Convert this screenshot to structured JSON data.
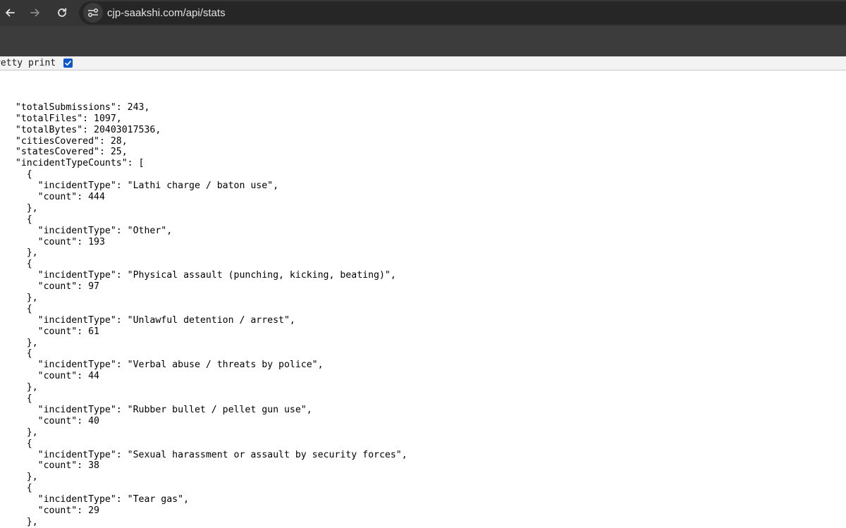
{
  "browser": {
    "url": "cjp-saakshi.com/api/stats"
  },
  "pretty_print": {
    "label": "retty print",
    "checked": true
  },
  "json_lines": [
    "",
    "  \"totalSubmissions\": 243,",
    "  \"totalFiles\": 1097,",
    "  \"totalBytes\": 20403017536,",
    "  \"citiesCovered\": 28,",
    "  \"statesCovered\": 25,",
    "  \"incidentTypeCounts\": [",
    "    {",
    "      \"incidentType\": \"Lathi charge / baton use\",",
    "      \"count\": 444",
    "    },",
    "    {",
    "      \"incidentType\": \"Other\",",
    "      \"count\": 193",
    "    },",
    "    {",
    "      \"incidentType\": \"Physical assault (punching, kicking, beating)\",",
    "      \"count\": 97",
    "    },",
    "    {",
    "      \"incidentType\": \"Unlawful detention / arrest\",",
    "      \"count\": 61",
    "    },",
    "    {",
    "      \"incidentType\": \"Verbal abuse / threats by police\",",
    "      \"count\": 44",
    "    },",
    "    {",
    "      \"incidentType\": \"Rubber bullet / pellet gun use\",",
    "      \"count\": 40",
    "    },",
    "    {",
    "      \"incidentType\": \"Sexual harassment or assault by security forces\",",
    "      \"count\": 38",
    "    },",
    "    {",
    "      \"incidentType\": \"Tear gas\",",
    "      \"count\": 29",
    "    },",
    "    {"
  ]
}
